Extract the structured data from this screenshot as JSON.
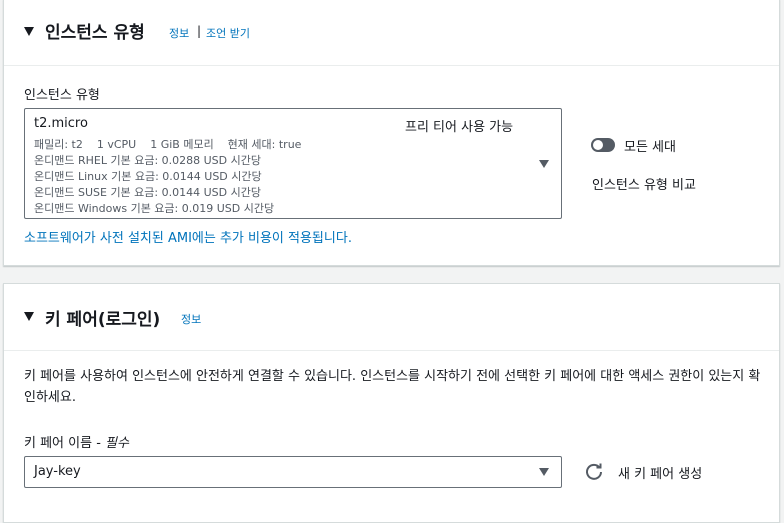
{
  "instance_type_section": {
    "title": "인스턴스 유형",
    "info_link": "정보",
    "separator": "|",
    "advice_link": "조언 받기",
    "field_label": "인스턴스 유형",
    "selected": {
      "name": "t2.micro",
      "free_tier": "프리 티어 사용 가능",
      "spec_line": "패밀리: t2    1 vCPU    1 GiB 메모리    현재 세대: true",
      "pricing": [
        "온디맨드 RHEL 기본 요금: 0.0288 USD 시간당",
        "온디맨드 Linux 기본 요금: 0.0144 USD 시간당",
        "온디맨드 SUSE 기본 요금: 0.0144 USD 시간당",
        "온디맨드 Windows 기본 요금: 0.019 USD 시간당"
      ]
    },
    "all_generations_toggle": {
      "label": "모든 세대",
      "checked": false
    },
    "compare_link": "인스턴스 유형 비교",
    "ami_note": "소프트웨어가 사전 설치된 AMI에는 추가 비용이 적용됩니다."
  },
  "key_pair_section": {
    "title": "키 페어(로그인)",
    "info_link": "정보",
    "description": "키 페어를 사용하여 인스턴스에 안전하게 연결할 수 있습니다. 인스턴스를 시작하기 전에 선택한 키 페어에 대한 액세스 권한이 있는지 확인하세요.",
    "field_label": "키 페어 이름 - ",
    "required_label": "필수",
    "selected_key": "Jay-key",
    "create_link": "새 키 페어 생성"
  },
  "icons": {
    "collapse_caret": "caret-down-icon",
    "dropdown_arrow": "dropdown-arrow-icon",
    "refresh": "refresh-icon"
  },
  "colors": {
    "link": "#0073bb",
    "text": "#16191f",
    "secondary_text": "#545b64",
    "background": "#f2f3f3"
  }
}
